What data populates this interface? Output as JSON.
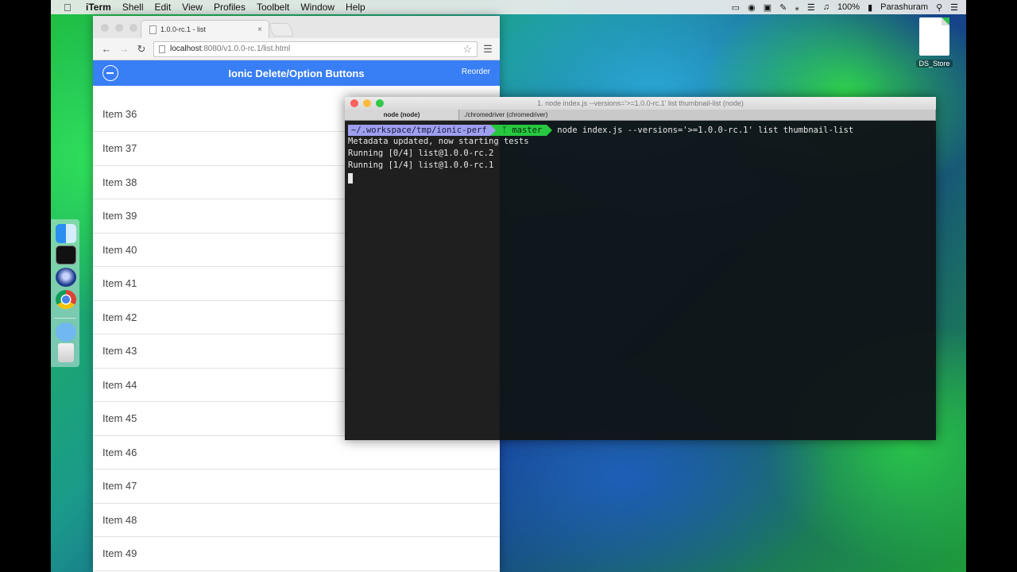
{
  "menubar": {
    "app": "iTerm",
    "items": [
      "Shell",
      "Edit",
      "View",
      "Profiles",
      "Toolbelt",
      "Window",
      "Help"
    ],
    "battery": "100%",
    "user": "Parashuram"
  },
  "desktop": {
    "file_label": "DS_Store"
  },
  "browser": {
    "tab_title": "1.0.0-rc.1 - list",
    "url_host": "localhost",
    "url_rest": ":8080/v1.0.0-rc.1/list.html",
    "header_title": "Ionic Delete/Option Buttons",
    "header_right": "Reorder",
    "items": [
      "Item 36",
      "Item 37",
      "Item 38",
      "Item 39",
      "Item 40",
      "Item 41",
      "Item 42",
      "Item 43",
      "Item 44",
      "Item 45",
      "Item 46",
      "Item 47",
      "Item 48",
      "Item 49"
    ]
  },
  "terminal": {
    "title": "1. node index.js --versions='>=1.0.0-rc.1' list thumbnail-list (node)",
    "tabs": [
      "node (node)",
      "./chromedriver (chromedriver)"
    ],
    "prompt_path": "~/.workspace/tmp/ionic-perf",
    "prompt_branch": "master",
    "command": "node index.js --versions='>=1.0.0-rc.1' list thumbnail-list",
    "lines": [
      "Metadata updated, now starting tests",
      "Running [0/4] list@1.0.0-rc.2",
      "Running [1/4] list@1.0.0-rc.1"
    ],
    "colors": {
      "path_bg": "#9f9ff0",
      "branch_bg": "#27c840",
      "close": "#fc615d",
      "minimize": "#fdbc40",
      "zoom": "#34c84a"
    }
  },
  "colors": {
    "ionic_header": "#387ef5"
  }
}
